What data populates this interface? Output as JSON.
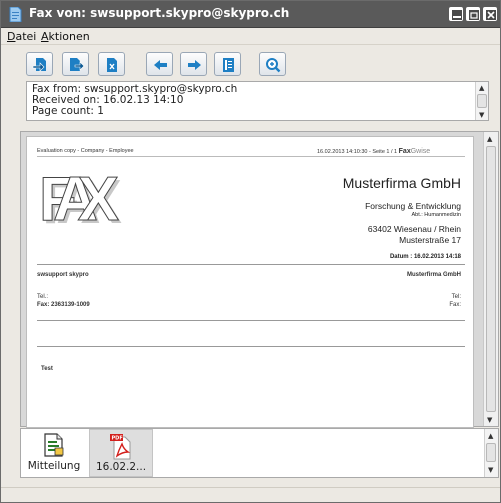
{
  "window": {
    "title": "Fax von:  swsupport.skypro@skypro.ch"
  },
  "menu": {
    "items": [
      {
        "label": "Datei",
        "mnemonic": "D",
        "rest": "atei"
      },
      {
        "label": "Aktionen",
        "mnemonic": "A",
        "rest": "ktionen"
      }
    ]
  },
  "toolbar": {
    "buttons": [
      "forward-icon",
      "export-icon",
      "pdf-export-icon",
      "arrow-left-icon",
      "arrow-right-icon",
      "document-icon",
      "zoom-icon"
    ]
  },
  "info": {
    "line1": "Fax from: swsupport.skypro@skypro.ch",
    "line2": "Received on: 16.02.13 14:10",
    "line3": "Page count: 1"
  },
  "fax_page": {
    "header_left": "Evaluation copy - Company - Employee",
    "header_right": "16.02.2013 14:10:30 - Seite 1 / 1",
    "brand_bold": "Fax",
    "brand_light": "Gwise",
    "logo_text": "FAX",
    "company_name": "Musterfirma GmbH",
    "department": "Forschung & Entwicklung",
    "sub_department": "Abt.: Humanmedizin",
    "city": "63402 Wiesenau / Rhein",
    "street": "Musterstraße 17",
    "date_line": "Datum : 16.02.2013 14:18",
    "sender": "swsupport skypro",
    "recipient": "Musterfirma GmbH",
    "tel_label": "Tel.:",
    "fax_label_left": "Fax: 2363139-1009",
    "tel_label_right": "Tel:",
    "fax_label_right": "Fax:",
    "message": "Test"
  },
  "attachments": [
    {
      "label": "Mitteilung",
      "icon": "memo-icon",
      "selected": false
    },
    {
      "label": "16.02.2...",
      "icon": "pdf-file-icon",
      "selected": true
    }
  ],
  "colors": {
    "titlebar": "#5a5a5a",
    "toolbar_icon": "#1e7fc4",
    "pdf_red": "#d3201c"
  }
}
